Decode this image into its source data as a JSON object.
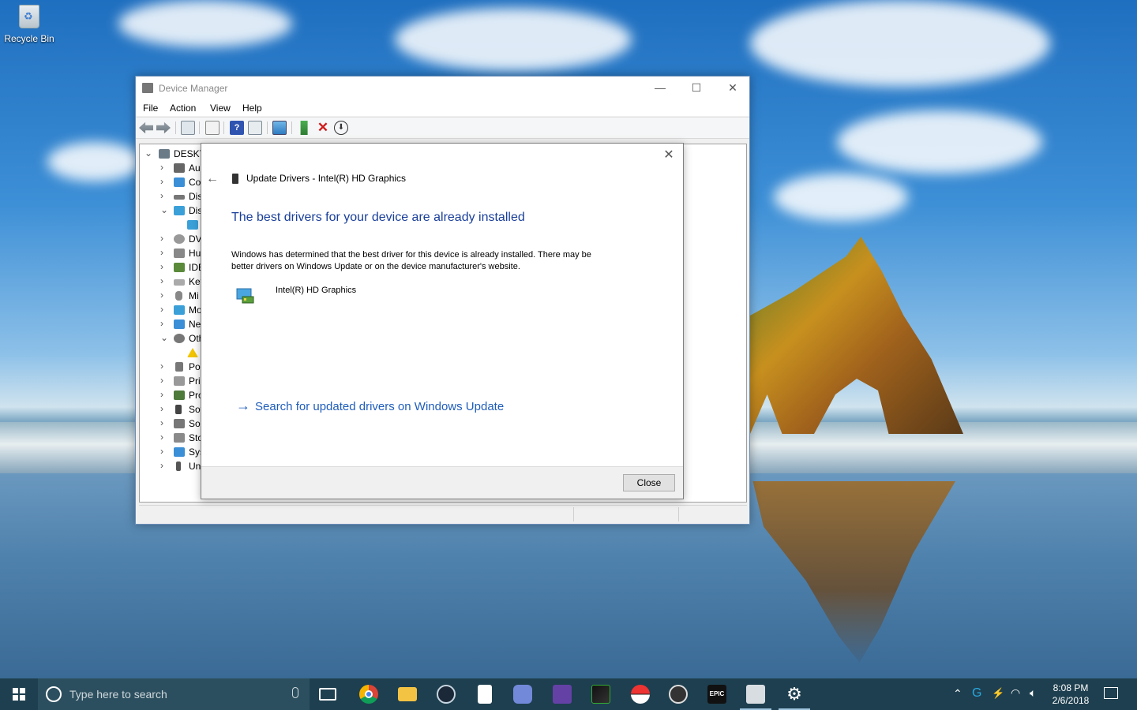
{
  "desktop": {
    "recycle_bin_label": "Recycle Bin"
  },
  "device_manager": {
    "title": "Device Manager",
    "menu": [
      "File",
      "Action",
      "View",
      "Help"
    ],
    "tree": {
      "root_label": "DESKT",
      "items": [
        {
          "label": "Au",
          "icon": "audio-icon",
          "expanded": false
        },
        {
          "label": "Co",
          "icon": "computer-icon",
          "expanded": false
        },
        {
          "label": "Dis",
          "icon": "disk-drive-icon",
          "expanded": false
        },
        {
          "label": "Dis",
          "icon": "display-adapter-icon",
          "expanded": true
        },
        {
          "label": "",
          "icon": "display-device-icon",
          "child": true
        },
        {
          "label": "DV",
          "icon": "dvd-icon",
          "expanded": false
        },
        {
          "label": "Hu",
          "icon": "hid-icon",
          "expanded": false
        },
        {
          "label": "IDE",
          "icon": "ide-icon",
          "expanded": false
        },
        {
          "label": "Key",
          "icon": "keyboard-icon",
          "expanded": false
        },
        {
          "label": "Mi",
          "icon": "mouse-icon",
          "expanded": false
        },
        {
          "label": "Mo",
          "icon": "monitor-icon",
          "expanded": false
        },
        {
          "label": "Ne",
          "icon": "network-icon",
          "expanded": false
        },
        {
          "label": "Oth",
          "icon": "other-devices-icon",
          "expanded": true
        },
        {
          "label": "",
          "icon": "warning-device-icon",
          "child": true
        },
        {
          "label": "Po",
          "icon": "port-icon",
          "expanded": false
        },
        {
          "label": "Pri",
          "icon": "print-queue-icon",
          "expanded": false
        },
        {
          "label": "Pro",
          "icon": "processor-icon",
          "expanded": false
        },
        {
          "label": "Sof",
          "icon": "software-device-icon",
          "expanded": false
        },
        {
          "label": "Sou",
          "icon": "sound-icon",
          "expanded": false
        },
        {
          "label": "Sto",
          "icon": "storage-icon",
          "expanded": false
        },
        {
          "label": "Sys",
          "icon": "system-devices-icon",
          "expanded": false
        },
        {
          "label": "Un",
          "icon": "usb-icon",
          "expanded": false
        }
      ]
    }
  },
  "dialog": {
    "header": "Update Drivers - Intel(R) HD Graphics",
    "heading": "The best drivers for your device are already installed",
    "description_line1": "Windows has determined that the best driver for this device is already installed. There may be",
    "description_line2": "better drivers on Windows Update or on the device manufacturer's website.",
    "device_name": "Intel(R) HD Graphics",
    "link": "Search for updated drivers on Windows Update",
    "close_button": "Close"
  },
  "taskbar": {
    "search_placeholder": "Type here to search",
    "time": "8:08 PM",
    "date": "2/6/2018",
    "apps": [
      "task-view",
      "chrome",
      "file-explorer",
      "steam",
      "notepad",
      "discord",
      "twitch",
      "stock-chart",
      "pokeball",
      "obs",
      "epic-games",
      "device-manager",
      "settings"
    ]
  }
}
